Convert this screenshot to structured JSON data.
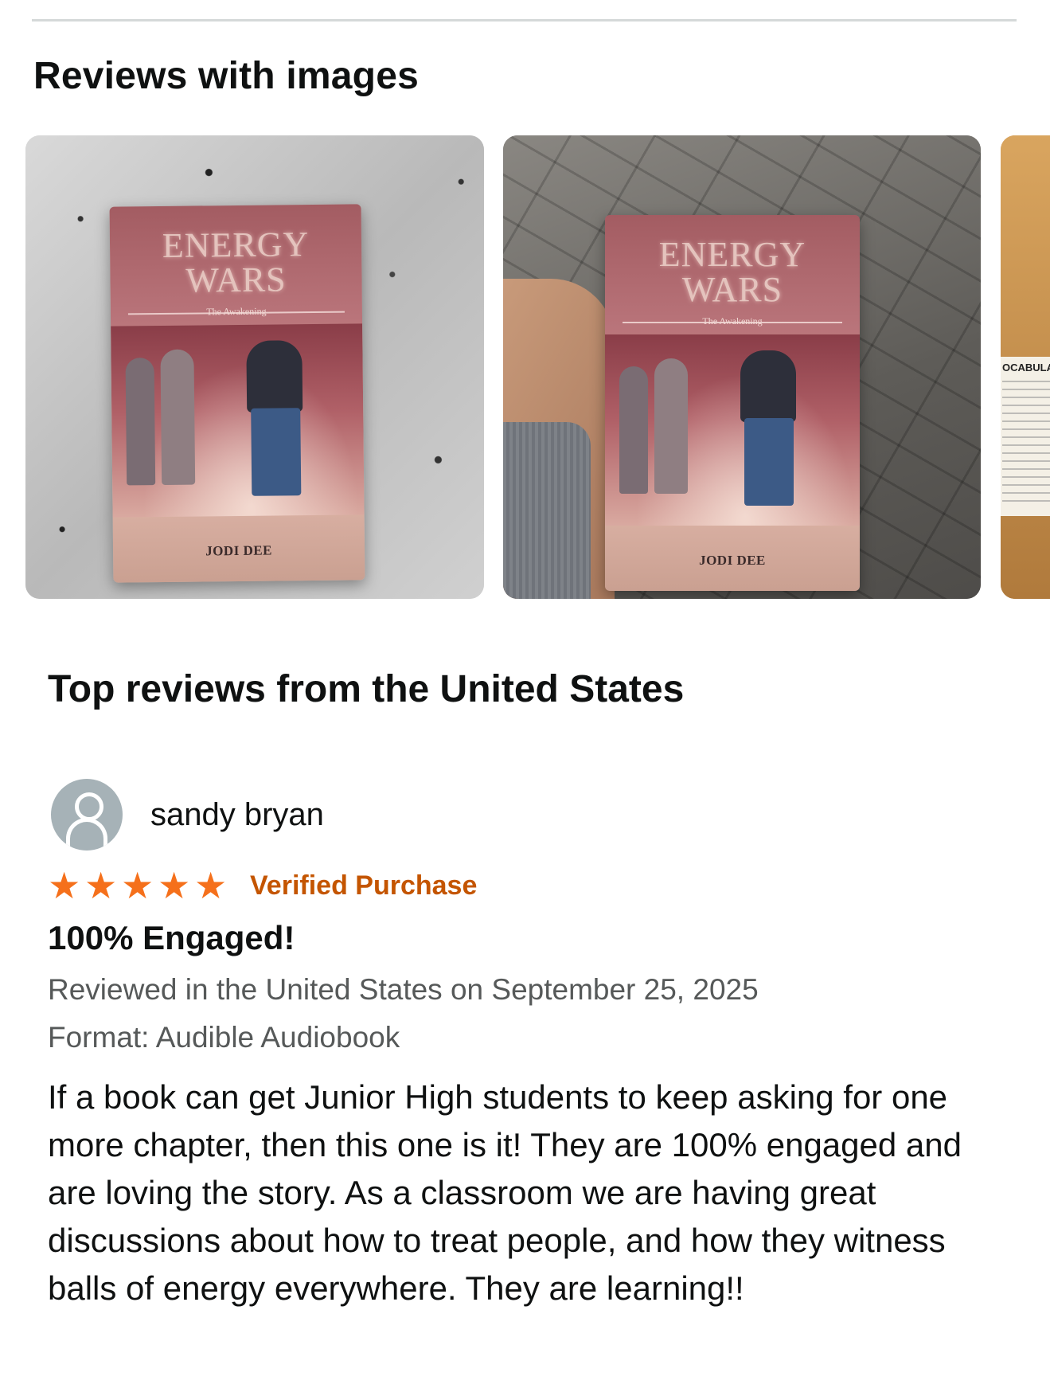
{
  "images_section": {
    "title": "Reviews with images",
    "images": [
      {
        "alt": "book-photo-on-granite",
        "book_title_line1": "ENERGY",
        "book_title_line2": "WARS",
        "book_subtitle": "The Awakening",
        "book_author": "JODI DEE"
      },
      {
        "alt": "book-photo-in-hand",
        "book_title_line1": "ENERGY",
        "book_title_line2": "WARS",
        "book_subtitle": "The Awakening",
        "book_author": "JODI DEE"
      },
      {
        "alt": "classroom-photo-partial",
        "visible_label": "OCABULARY"
      }
    ]
  },
  "top_reviews": {
    "title": "Top reviews from the United States"
  },
  "review": {
    "reviewer_name": "sandy bryan",
    "rating": 5,
    "rating_max": 5,
    "star_glyph": "★",
    "verified_label": "Verified Purchase",
    "title": "100% Engaged!",
    "date_line": "Reviewed in the United States on September 25, 2025",
    "format_line": "Format: Audible Audiobook",
    "body": "If a book can get Junior High students to keep asking for one more chapter, then this one is it! They are 100% engaged and are loving the story. As a classroom we are having great discussions about how to treat people, and how they witness balls of energy everywhere. They are learning!!"
  },
  "colors": {
    "star": "#f5701b",
    "verified": "#c45500",
    "meta_text": "#565959",
    "avatar_bg": "#a6b2b7"
  }
}
